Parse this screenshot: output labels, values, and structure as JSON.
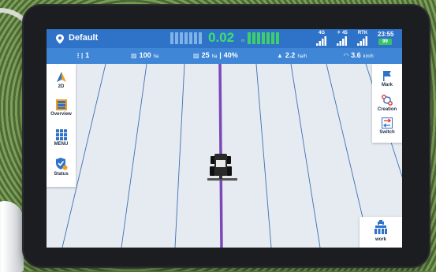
{
  "status_bar": {
    "project_name": "Default",
    "deviation_value": "0.02",
    "deviation_unit": "m",
    "signal_4g_label": "4G",
    "satellite_count": "45",
    "rtk_label": "RTK",
    "time": "23:55",
    "battery_percent": "99"
  },
  "info_bar": {
    "line_number": "1",
    "area_value": "100",
    "area_unit": "ha",
    "worked_area_value": "25",
    "worked_area_unit": "ha",
    "progress_percent": "40%",
    "speed_value": "2.2",
    "speed_unit": "ha/h",
    "rate_value": "3.6",
    "rate_unit": "km/h"
  },
  "left_menu": [
    {
      "label": "2D",
      "icon": "navigation-arrow-icon"
    },
    {
      "label": "Overview",
      "icon": "overview-icon"
    },
    {
      "label": "MENU",
      "icon": "grid-menu-icon"
    },
    {
      "label": "Status",
      "icon": "status-shield-icon"
    }
  ],
  "right_menu": [
    {
      "label": "Mark",
      "icon": "flag-icon"
    },
    {
      "label": "Creation",
      "icon": "line-creation-icon"
    },
    {
      "label": "Switch",
      "icon": "switch-line-icon"
    }
  ],
  "work_button": {
    "label": "work",
    "icon": "work-implement-icon"
  },
  "colors": {
    "status_bar": "#2f73c9",
    "info_bar": "#3f86d6",
    "field_background": "#e6ebf2",
    "guidance_line": "#7c48b8",
    "deviation_green": "#3ee06c"
  }
}
